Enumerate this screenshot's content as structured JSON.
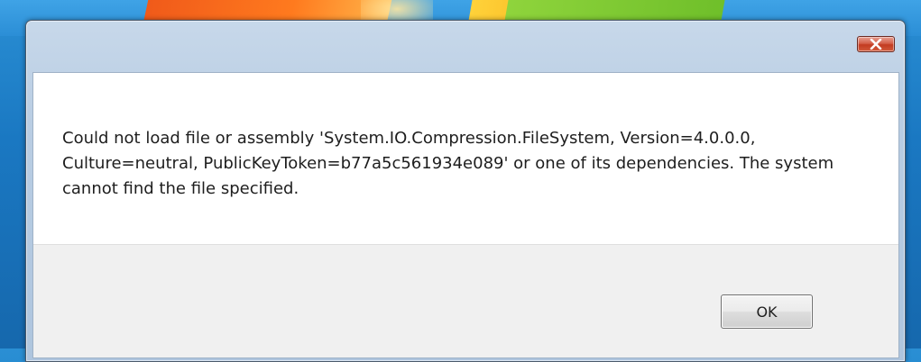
{
  "dialog": {
    "message": "Could not load file or assembly 'System.IO.Compression.FileSystem, Version=4.0.0.0, Culture=neutral, PublicKeyToken=b77a5c561934e089' or one of its dependencies. The system cannot find the file specified.",
    "ok_label": "OK",
    "close_icon": "close-icon"
  },
  "colors": {
    "close_button": "#c23b21",
    "titlebar": "#b9cde3",
    "content_bg": "#ffffff",
    "footer_bg": "#f0f0f0",
    "text": "#1e1e1e"
  }
}
